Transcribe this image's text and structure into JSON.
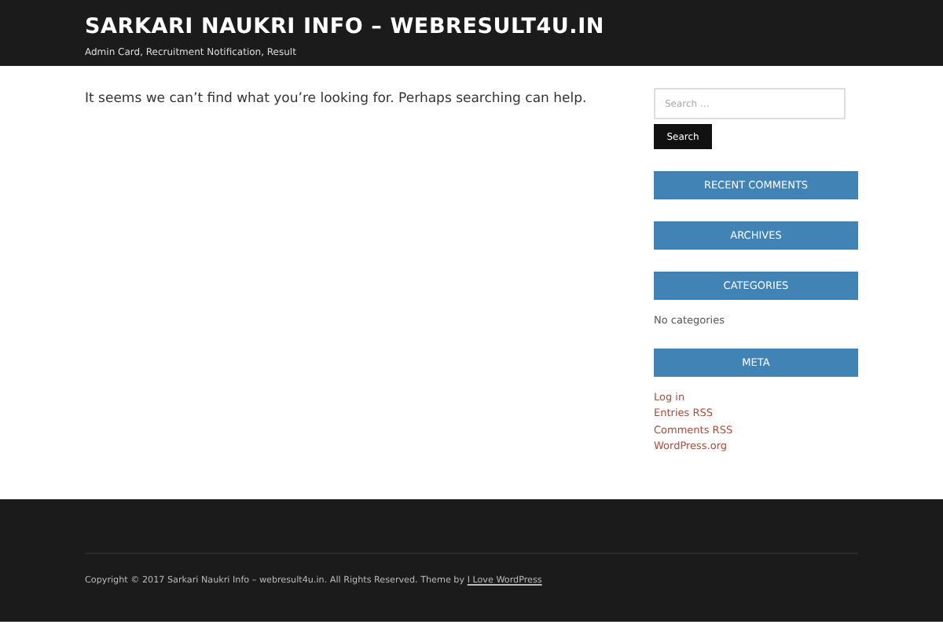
{
  "header": {
    "site_title": "SARKARI NAUKRI INFO – WEBRESULT4U.IN",
    "tagline": "Admin Card, Recruitment Notification, Result"
  },
  "main": {
    "message": "It seems we can’t find what you’re looking for. Perhaps searching can help."
  },
  "sidebar": {
    "search": {
      "placeholder": "Search …",
      "button": "Search"
    },
    "widgets": [
      {
        "title": "RECENT COMMENTS",
        "kind": "empty"
      },
      {
        "title": "ARCHIVES",
        "kind": "empty"
      },
      {
        "title": "CATEGORIES",
        "kind": "text",
        "text": "No categories"
      },
      {
        "title": "META",
        "kind": "links",
        "links": [
          "Log in",
          "Entries RSS",
          "Comments RSS",
          "WordPress.org"
        ]
      }
    ]
  },
  "footer": {
    "copyright": "Copyright © 2017 Sarkari Naukri Info – webresult4u.in. All Rights Reserved. Theme by",
    "link": "I Love WordPress"
  }
}
